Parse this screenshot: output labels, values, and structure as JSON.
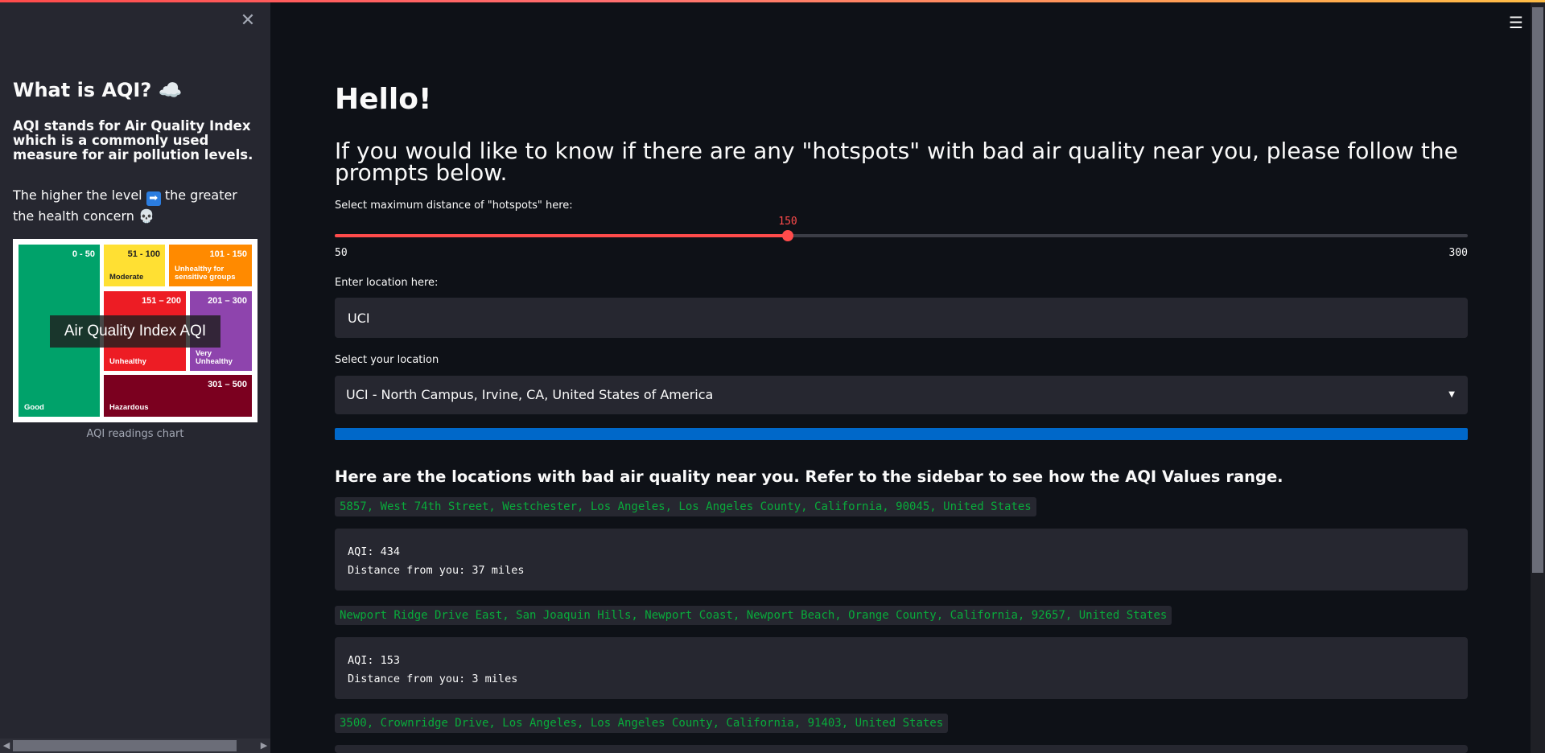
{
  "sidebar": {
    "close_icon": "close-icon",
    "title": "What is AQI? ☁️",
    "bold_text": "AQI stands for Air Quality Index which is a commonly used measure for air pollution levels.",
    "text_before": "The higher the level",
    "arrow_icon": "➡",
    "text_after": "the greater the health concern 💀",
    "chart": {
      "overlay": "Air Quality Index AQI",
      "cells": [
        {
          "range": "0 - 50",
          "label": "Good",
          "color": "#00a26a"
        },
        {
          "range": "51 - 100",
          "label": "Moderate",
          "color": "#ffe033"
        },
        {
          "range": "101 - 150",
          "label": "Unhealthy for sensitive groups",
          "color": "#ff8a00"
        },
        {
          "range": "151 – 200",
          "label": "Unhealthy",
          "color": "#ed1c24"
        },
        {
          "range": "201 – 300",
          "label": "Very Unhealthy",
          "color": "#8e44ad"
        },
        {
          "range": "301 – 500",
          "label": "Hazardous",
          "color": "#7b001f"
        }
      ]
    },
    "caption": "AQI readings chart"
  },
  "header": {
    "menu_icon": "hamburger-menu-icon"
  },
  "main": {
    "greeting": "Hello!",
    "intro": "If you would like to know if there are any \"hotspots\" with bad air quality near you, please follow the prompts below.",
    "slider": {
      "label": "Select maximum distance of \"hotspots\" here:",
      "value": "150",
      "min": "50",
      "max": "300",
      "fraction": 0.4
    },
    "location_input": {
      "label": "Enter location here:",
      "value": "UCI"
    },
    "location_select": {
      "label": "Select your location",
      "value": "UCI - North Campus, Irvine, CA, United States of America"
    },
    "progress": 1.0,
    "results_heading": "Here are the locations with bad air quality near you. Refer to the sidebar to see how the AQI Values range.",
    "results": [
      {
        "address": "5857, West 74th Street, Westchester, Los Angeles, Los Angeles County, California, 90045, United States",
        "aqi": "AQI: 434",
        "distance": "Distance from you: 37 miles"
      },
      {
        "address": "Newport Ridge Drive East, San Joaquin Hills, Newport Coast, Newport Beach, Orange County, California, 92657, United States",
        "aqi": "AQI: 153",
        "distance": "Distance from you: 3 miles"
      },
      {
        "address": "3500, Crownridge Drive, Los Angeles, Los Angeles County, California, 91403, United States",
        "aqi": "",
        "distance": ""
      }
    ]
  },
  "colors": {
    "background": "#0e1117",
    "sidebar": "#262730",
    "accent": "#ff4b4b",
    "progress": "#0068c9",
    "address": "#09ab3b"
  }
}
